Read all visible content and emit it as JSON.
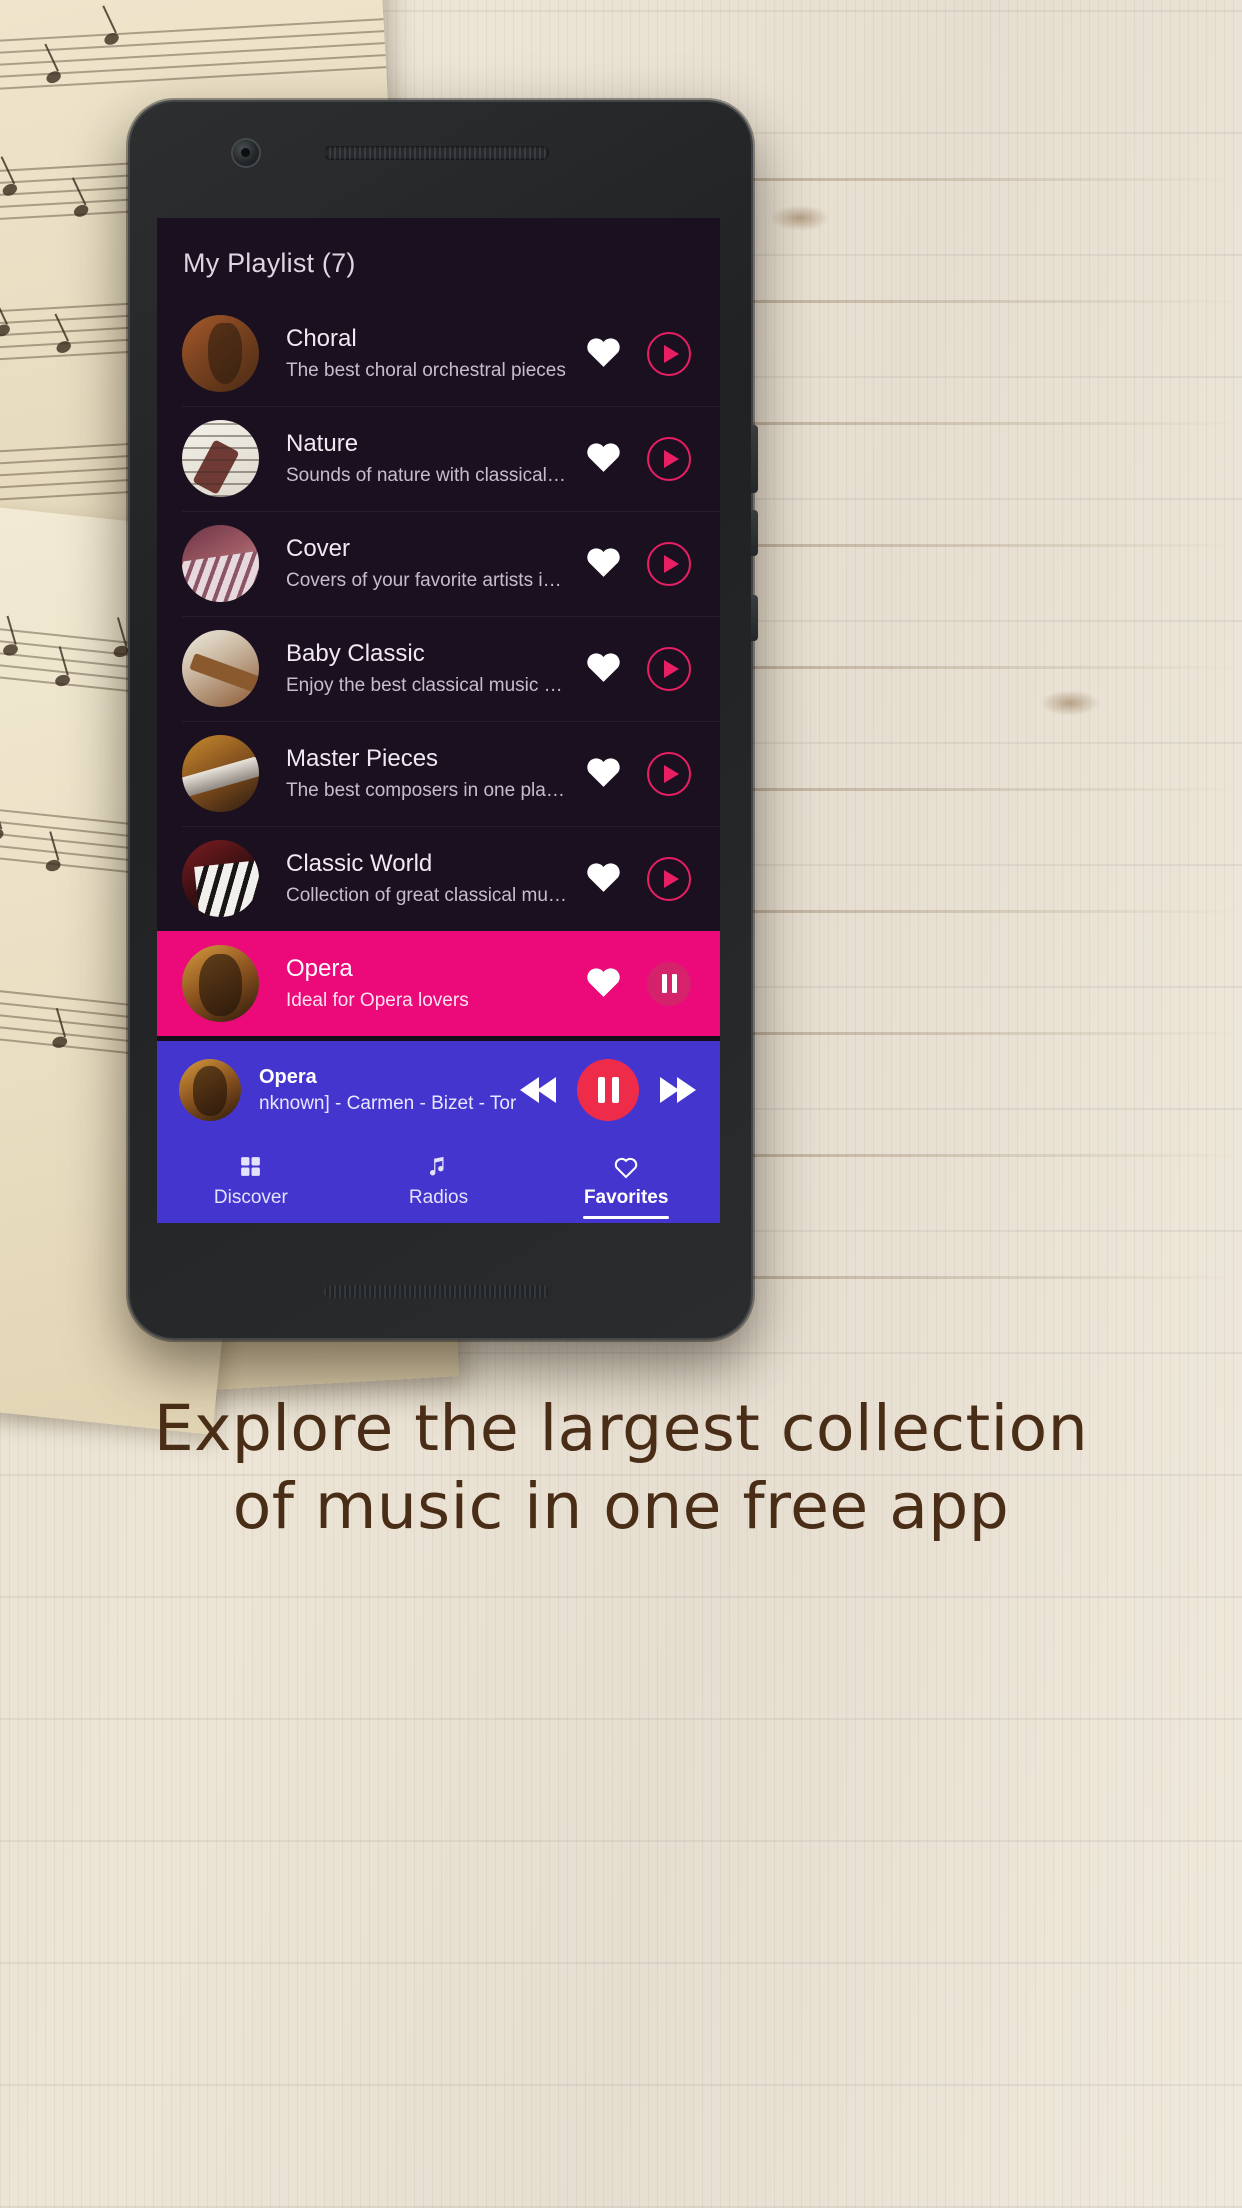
{
  "app": {
    "header_title": "My Playlist (7)",
    "accent_pink": "#ec0a7b",
    "accent_red": "#e81f63",
    "player_blue": "#4535cf",
    "screen_bg": "#1b1020"
  },
  "playlist": [
    {
      "name": "Choral",
      "desc": "The best choral orchestral pieces",
      "art": "art-violin",
      "favorite_icon": "heart-icon",
      "action_icon": "play-icon",
      "active": false
    },
    {
      "name": "Nature",
      "desc": "Sounds of nature with classical music i…",
      "art": "art-sheet",
      "favorite_icon": "heart-icon",
      "action_icon": "play-icon",
      "active": false
    },
    {
      "name": "Cover",
      "desc": "Covers of your favorite artists in acousti…",
      "art": "art-piano",
      "favorite_icon": "heart-icon",
      "action_icon": "play-icon",
      "active": false
    },
    {
      "name": "Baby Classic",
      "desc": "Enjoy the best classical music with your…",
      "art": "art-bow",
      "favorite_icon": "heart-icon",
      "action_icon": "play-icon",
      "active": false
    },
    {
      "name": "Master Pieces",
      "desc": "The best composers in one place.",
      "art": "art-flute",
      "favorite_icon": "heart-icon",
      "action_icon": "play-icon",
      "active": false
    },
    {
      "name": "Classic World",
      "desc": "Collection of great classical music",
      "art": "art-keys",
      "favorite_icon": "heart-icon",
      "action_icon": "play-icon",
      "active": false
    },
    {
      "name": "Opera",
      "desc": "Ideal for Opera lovers",
      "art": "art-opera",
      "favorite_icon": "heart-icon",
      "action_icon": "pause-icon",
      "active": true
    }
  ],
  "player": {
    "title": "Opera",
    "subtitle": "nknown] - Carmen - Bizet - Toréa",
    "prev_icon": "rewind-icon",
    "play_pause_icon": "pause-icon",
    "next_icon": "fast-forward-icon"
  },
  "bottom_nav": [
    {
      "label": "Discover",
      "icon": "grid-icon",
      "selected": false
    },
    {
      "label": "Radios",
      "icon": "music-note-icon",
      "selected": false
    },
    {
      "label": "Favorites",
      "icon": "heart-outline-icon",
      "selected": true
    }
  ],
  "caption": {
    "line1": "Explore the largest collection",
    "line2": "of music in one free app"
  }
}
